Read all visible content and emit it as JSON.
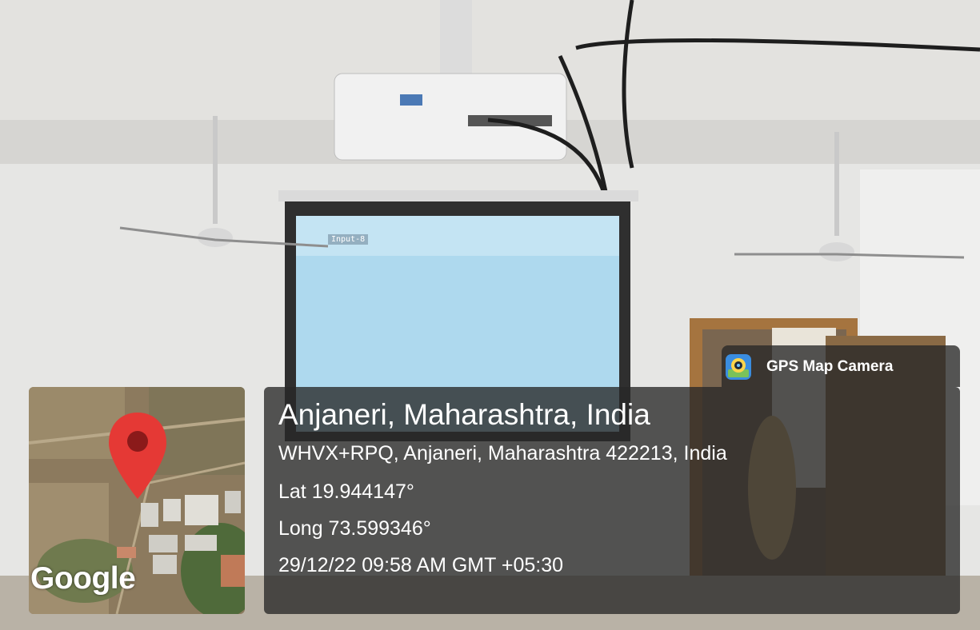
{
  "screen_overlay": "Input-8",
  "map_thumbnail": {
    "attribution": "Google",
    "marker_icon": "location-pin-icon"
  },
  "badge": {
    "app_icon": "gps-map-camera-icon",
    "label": "GPS Map Camera"
  },
  "location": {
    "title": "Anjaneri, Maharashtra, India",
    "address": "WHVX+RPQ, Anjaneri, Maharashtra 422213, India",
    "latitude": "Lat 19.944147°",
    "longitude": "Long 73.599346°",
    "timestamp": "29/12/22 09:58 AM GMT +05:30"
  },
  "colors": {
    "pin": "#e53935",
    "pin_dot": "#8b1a1a",
    "panel": "#282828"
  }
}
